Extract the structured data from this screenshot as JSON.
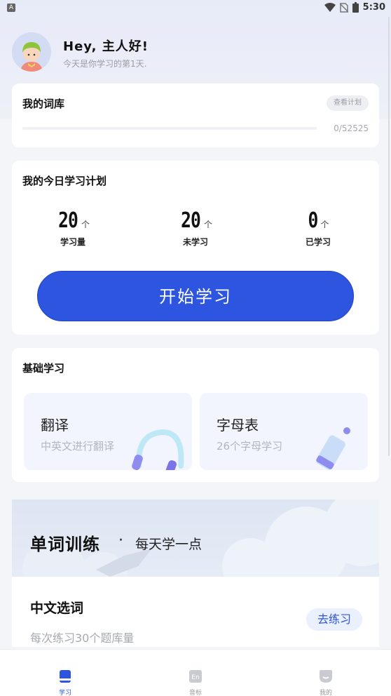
{
  "status_bar": {
    "notif_letter": "A",
    "time": "5:30"
  },
  "header": {
    "greeting": "Hey, 主人好!",
    "subtitle": "今天是你学习的第1天."
  },
  "vocab": {
    "title": "我的词库",
    "plan_button": "查看计划",
    "progress_fraction": 0,
    "count": "0/52525"
  },
  "plan": {
    "title": "我的今日学习计划",
    "stats": [
      {
        "value": "20",
        "unit": "个",
        "label": "学习量"
      },
      {
        "value": "20",
        "unit": "个",
        "label": "未学习"
      },
      {
        "value": "0",
        "unit": "个",
        "label": "已学习"
      }
    ],
    "start_button": "开始学习"
  },
  "basic": {
    "title": "基础学习",
    "tiles": [
      {
        "title": "翻译",
        "subtitle": "中英文进行翻译",
        "icon": "headphones-icon"
      },
      {
        "title": "字母表",
        "subtitle": "26个字母学习",
        "icon": "pencil-icon"
      }
    ]
  },
  "training": {
    "title": "单词训练",
    "dot": "·",
    "subtitle": "每天学一点",
    "item_title": "中文选词",
    "item_subtitle": "每次练习30个题库量",
    "practice_button": "去练习"
  },
  "nav": {
    "items": [
      {
        "label": "学习",
        "icon": "book-icon",
        "active": true
      },
      {
        "label": "音标",
        "icon": "phonetic-icon",
        "active": false
      },
      {
        "label": "我的",
        "icon": "profile-icon",
        "active": false
      }
    ]
  },
  "colors": {
    "accent": "#2d55e0",
    "background": "#f4f5f9"
  }
}
